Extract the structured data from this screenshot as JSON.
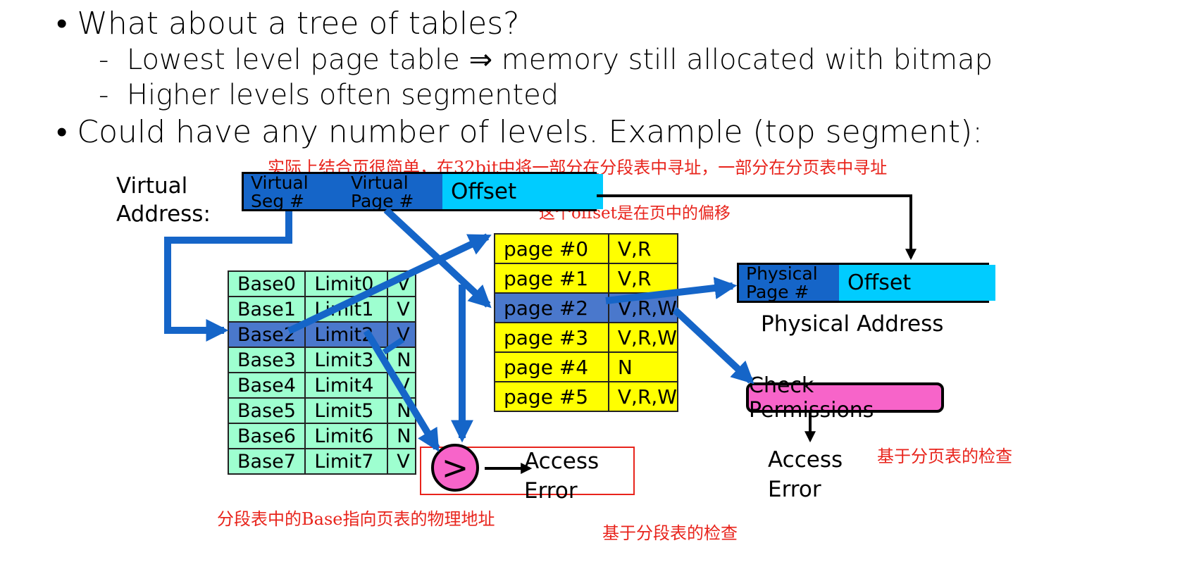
{
  "bullets": {
    "b1": "What about a tree of tables?",
    "b1_sub1": "Lowest level page table ⇒ memory still allocated with bitmap",
    "b1_sub2": "Higher levels often segmented",
    "b2": "Could have any number of levels. Example (top segment):",
    "bullet_mark": "•",
    "dash_mark": "-"
  },
  "annotations": {
    "combine_note": "实际上结合页很简单，在32bit中将一部分在分段表中寻址，一部分在分页表中寻址",
    "offset_note": "这个offset是在页中的偏移",
    "base_note": "分段表中的Base指向页表的物理地址",
    "seg_check_note": "基于分段表的检查",
    "page_check_note": "基于分页表的检查"
  },
  "virtual_address": {
    "label_line1": "Virtual",
    "label_line2": "Address:",
    "seg_line1": "Virtual",
    "seg_line2": "Seg #",
    "page_line1": "Virtual",
    "page_line2": "Page #",
    "offset": "Offset"
  },
  "segment_table": {
    "rows": [
      {
        "base": "Base0",
        "limit": "Limit0",
        "flag": "V"
      },
      {
        "base": "Base1",
        "limit": "Limit1",
        "flag": "V"
      },
      {
        "base": "Base2",
        "limit": "Limit2",
        "flag": "V"
      },
      {
        "base": "Base3",
        "limit": "Limit3",
        "flag": "N"
      },
      {
        "base": "Base4",
        "limit": "Limit4",
        "flag": "V"
      },
      {
        "base": "Base5",
        "limit": "Limit5",
        "flag": "N"
      },
      {
        "base": "Base6",
        "limit": "Limit6",
        "flag": "N"
      },
      {
        "base": "Base7",
        "limit": "Limit7",
        "flag": "V"
      }
    ],
    "selected_index": 2
  },
  "page_table": {
    "rows": [
      {
        "page": "page #0",
        "perm": "V,R"
      },
      {
        "page": "page #1",
        "perm": "V,R"
      },
      {
        "page": "page #2",
        "perm": "V,R,W"
      },
      {
        "page": "page #3",
        "perm": "V,R,W"
      },
      {
        "page": "page #4",
        "perm": "N"
      },
      {
        "page": "page #5",
        "perm": "V,R,W"
      }
    ],
    "selected_index": 2
  },
  "physical_address": {
    "page_line1": "Physical",
    "page_line2": "Page #",
    "offset": "Offset",
    "caption": "Physical Address"
  },
  "comparator": {
    "symbol": ">"
  },
  "access_error_left": {
    "line1": "Access",
    "line2": "Error"
  },
  "check_permissions": {
    "label": "Check Permissions"
  },
  "access_error_right": {
    "line1": "Access",
    "line2": "Error"
  },
  "colors": {
    "arrow_blue": "#1565c8",
    "dark_blue": "#1565c8",
    "cyan": "#00ccff",
    "seg_green": "#9effd0",
    "page_yellow": "#ffff00",
    "selected_row": "#4a78cc",
    "pink": "#f764c9",
    "note_red": "#e8241c"
  }
}
